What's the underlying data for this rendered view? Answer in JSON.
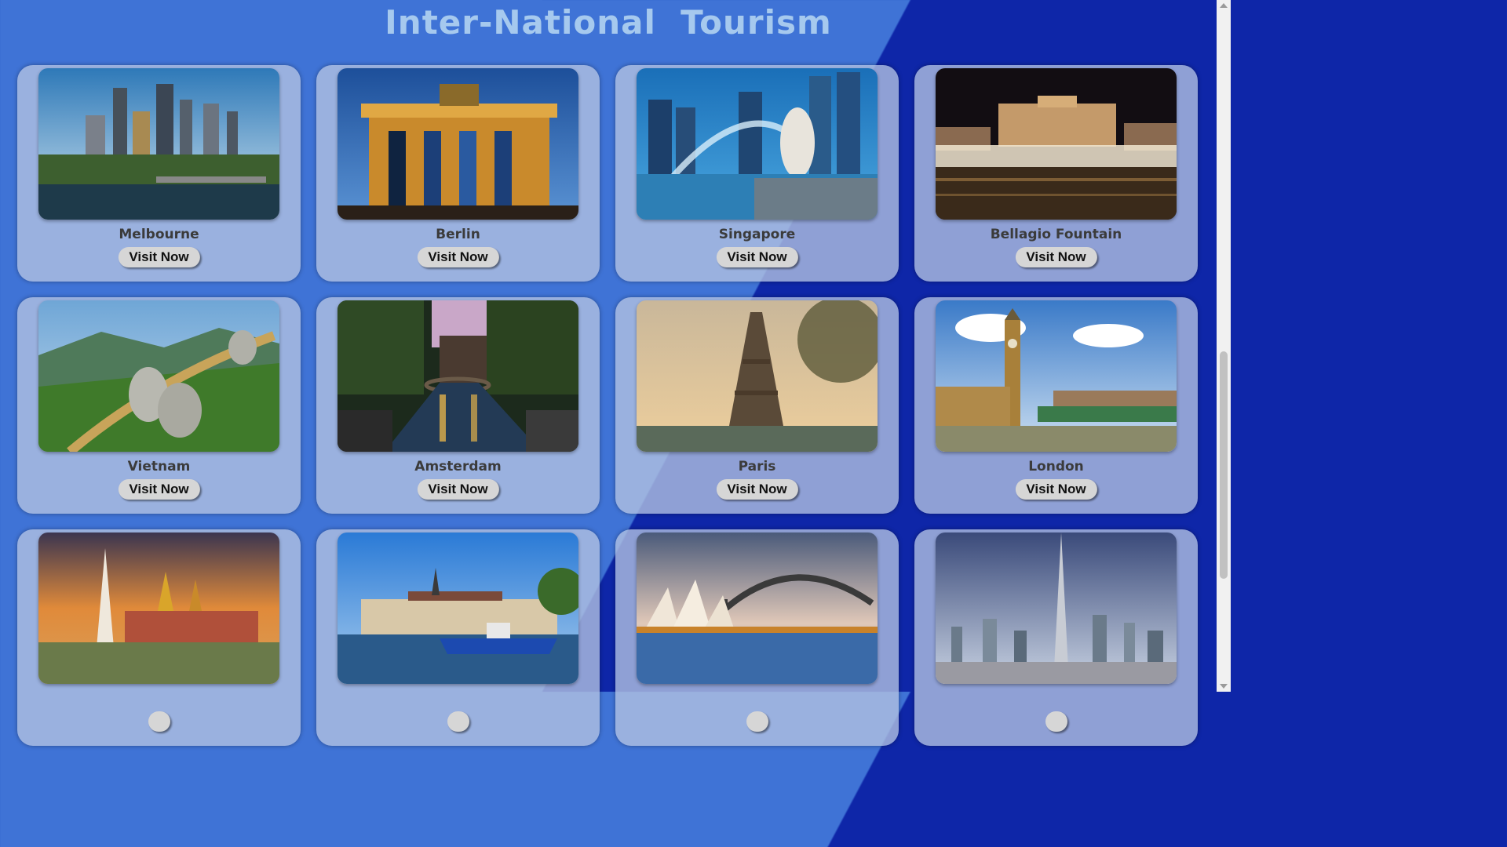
{
  "page_title": "Inter-National  Tourism",
  "colors": {
    "background_left": "#3f73d6",
    "background_right": "#0e26a8",
    "title": "#a6c9ee",
    "card": "#b4c3e1",
    "button": "#d6d6d6"
  },
  "cards": [
    {
      "name": "Melbourne",
      "button": "Visit Now",
      "image": "melbourne-skyline-photo"
    },
    {
      "name": "Berlin",
      "button": "Visit Now",
      "image": "brandenburg-gate-photo"
    },
    {
      "name": "Singapore",
      "button": "Visit Now",
      "image": "merlion-photo"
    },
    {
      "name": "Bellagio Fountain",
      "button": "Visit Now",
      "image": "bellagio-fountain-photo"
    },
    {
      "name": "Vietnam",
      "button": "Visit Now",
      "image": "golden-bridge-hands-photo"
    },
    {
      "name": "Amsterdam",
      "button": "Visit Now",
      "image": "canal-at-dusk-photo"
    },
    {
      "name": "Paris",
      "button": "Visit Now",
      "image": "eiffel-tower-photo"
    },
    {
      "name": "London",
      "button": "Visit Now",
      "image": "big-ben-bridge-photo"
    },
    {
      "name": "",
      "button": "",
      "image": "grand-palace-photo"
    },
    {
      "name": "",
      "button": "",
      "image": "harbor-boat-photo"
    },
    {
      "name": "",
      "button": "",
      "image": "opera-house-bridge-photo"
    },
    {
      "name": "",
      "button": "",
      "image": "burj-khalifa-photo"
    }
  ]
}
